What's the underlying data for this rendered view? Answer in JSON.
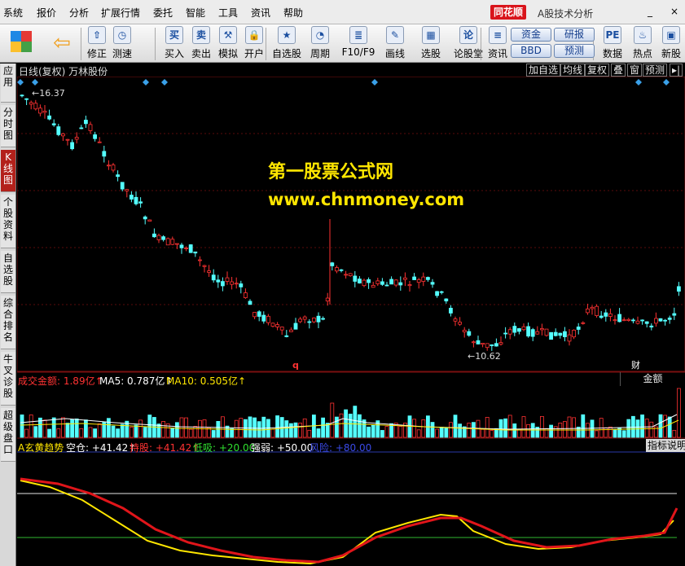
{
  "menu": {
    "items": [
      "系统",
      "报价",
      "分析",
      "扩展行情",
      "委托",
      "智能",
      "工具",
      "资讯",
      "帮助"
    ],
    "brand": "同花顺",
    "subtitle": "A股技术分析"
  },
  "toolbar": {
    "buttons": [
      {
        "label": "修正",
        "icon": "arrow-up-icon",
        "glyph": "⇧"
      },
      {
        "label": "测速",
        "icon": "clock-icon",
        "glyph": "◷"
      },
      {
        "label": "买入",
        "icon": "buy-icon",
        "glyph": "买"
      },
      {
        "label": "卖出",
        "icon": "sell-icon",
        "glyph": "卖"
      },
      {
        "label": "模拟",
        "icon": "hammer-icon",
        "glyph": "⚒"
      },
      {
        "label": "开户",
        "icon": "lock-icon",
        "glyph": "🔒"
      },
      {
        "label": "自选股",
        "icon": "star-icon",
        "glyph": "★"
      },
      {
        "label": "周期",
        "icon": "clock-icon",
        "glyph": "◔"
      },
      {
        "label": "F10/F9",
        "icon": "document-icon",
        "glyph": "≣"
      },
      {
        "label": "画线",
        "icon": "pen-icon",
        "glyph": "✎"
      },
      {
        "label": "选股",
        "icon": "chart-icon",
        "glyph": "▦"
      },
      {
        "label": "论股堂",
        "icon": "discuss-icon",
        "glyph": "论"
      },
      {
        "label": "资讯",
        "icon": "news-icon",
        "glyph": "≡"
      },
      {
        "label": "数据",
        "icon": "pe-icon",
        "glyph": "PE"
      },
      {
        "label": "热点",
        "icon": "hot-icon",
        "glyph": "♨"
      },
      {
        "label": "新股",
        "icon": "new-stock-icon",
        "glyph": "▣"
      }
    ],
    "pills": [
      "资金",
      "研报",
      "BBD",
      "预测"
    ]
  },
  "left_tabs": [
    "应用",
    "分时图",
    "K线图",
    "个股资料",
    "自选股",
    "综合排名",
    "牛叉诊股",
    "超级盘口"
  ],
  "chart_header": {
    "title": "日线(复权) 万林股份",
    "buttons": [
      "加自选",
      "均线",
      "复权",
      "叠",
      "窗",
      "预测"
    ]
  },
  "kline": {
    "high_label": "16.37",
    "low_label": "10.62",
    "q_marker": "q",
    "cai_marker": "财"
  },
  "watermark": {
    "title": "第一股票公式网",
    "url": "www.chnmoney.com"
  },
  "volume": {
    "amount_label": "成交金额: 1.89亿↑",
    "ma5": "MA5: 0.787亿↑",
    "ma10": "MA10: 0.505亿↑",
    "tag": "金额"
  },
  "indicator": {
    "name": "A玄黄趋势",
    "kong_cang": "空仓: +41.42↑",
    "chi_gu": "持股: +41.42↑",
    "di_xi": "低吸: +20.00",
    "qiang_ruo": "强弱: +50.00",
    "feng_xian": "风险: +80.00",
    "help": "指标说明"
  },
  "colors": {
    "up": "#ff3232",
    "down": "#54ffff",
    "marker": "#3aa0e8",
    "ma5": "#ffffff",
    "ma10": "#ffe600",
    "watermark": "#ffe600",
    "indicator_red": "#e0151a",
    "indicator_yellow": "#ffe600",
    "indicator_green": "#2fb82f"
  }
}
